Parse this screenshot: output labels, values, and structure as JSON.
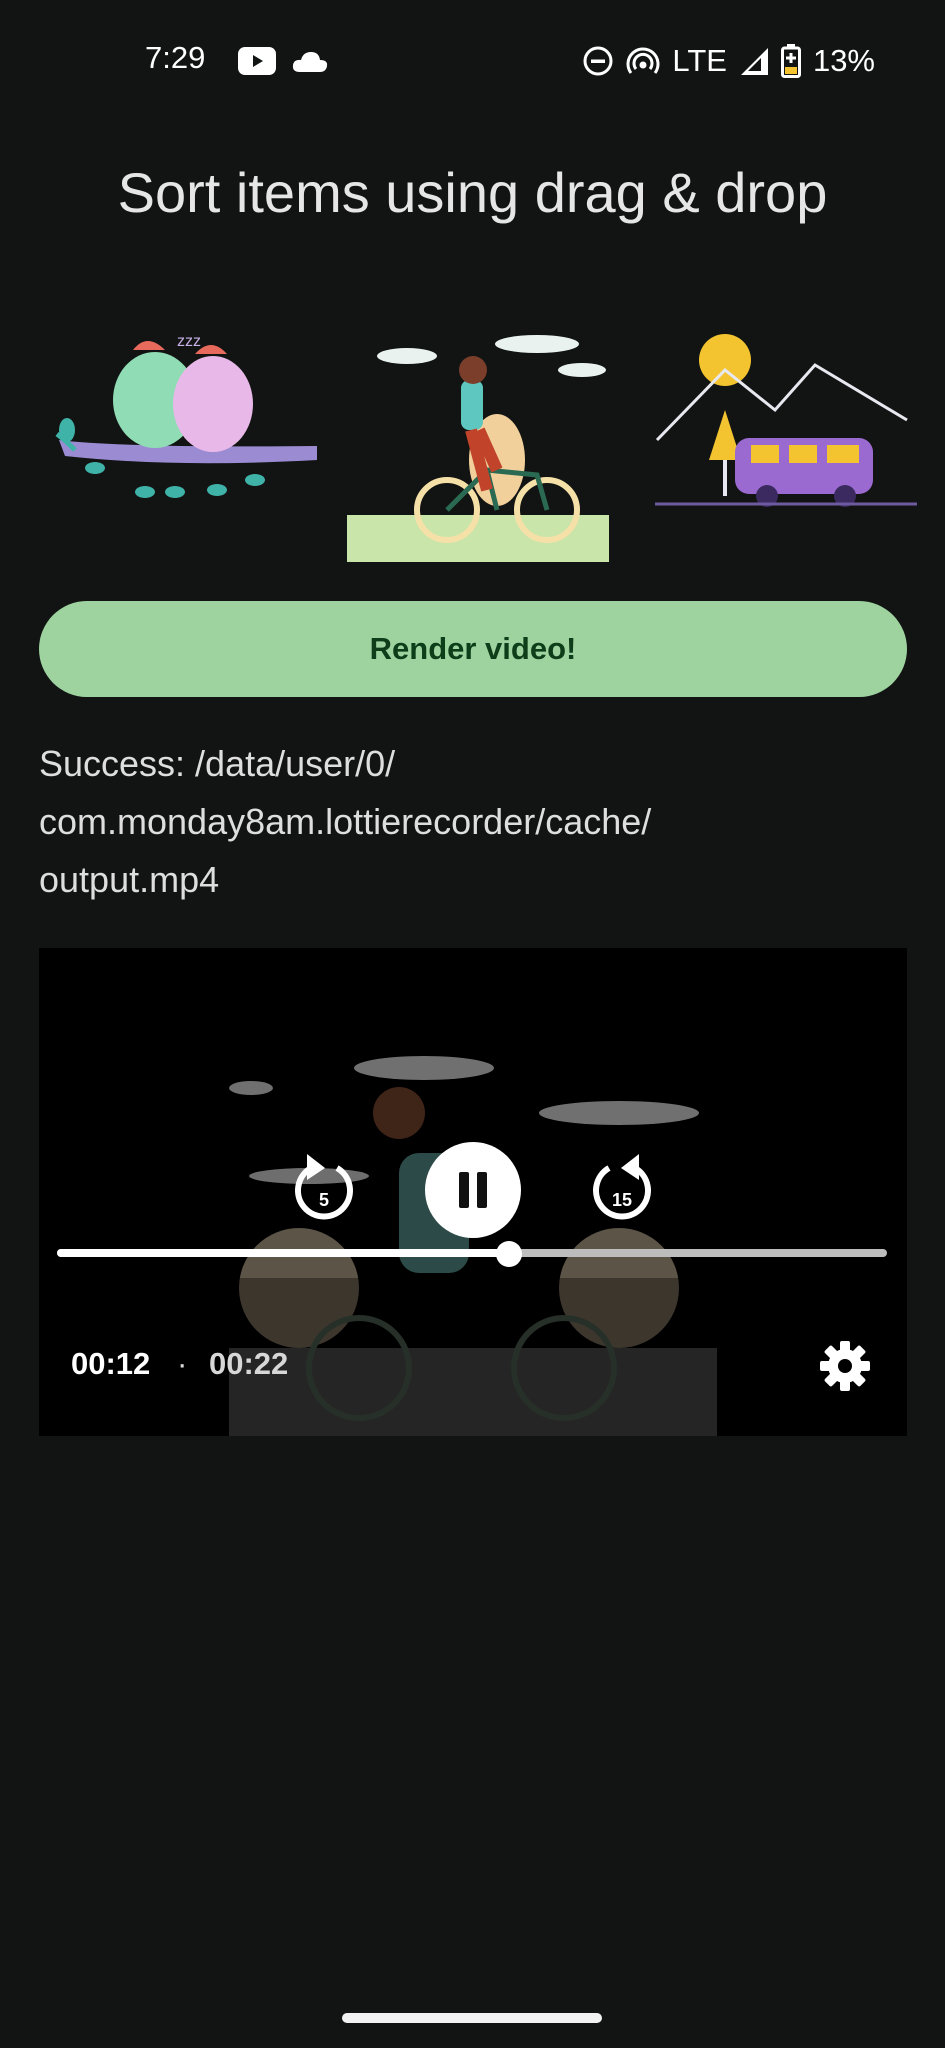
{
  "status_bar": {
    "time": "7:29",
    "network": "LTE",
    "battery": "13%",
    "icons": [
      "youtube-icon",
      "cloud-icon",
      "dnd-icon",
      "hotspot-icon",
      "signal-icon",
      "battery-icon"
    ]
  },
  "title": "Sort items using drag & drop",
  "thumbnails": [
    {
      "name": "birds-animation"
    },
    {
      "name": "cyclist-animation"
    },
    {
      "name": "camper-van-animation"
    }
  ],
  "render_button": "Render video!",
  "result_lines": [
    "Success: /data/user/0/",
    "com.monday8am.lottierecorder/cache/",
    "output.mp4"
  ],
  "player": {
    "position": "00:12",
    "separator": "·",
    "duration": "00:22",
    "rewind_seconds": "5",
    "forward_seconds": "15",
    "progress_fraction": 0.545
  },
  "colors": {
    "background": "#111412",
    "button": "#9ed3a0",
    "button_text": "#0e3e19"
  }
}
